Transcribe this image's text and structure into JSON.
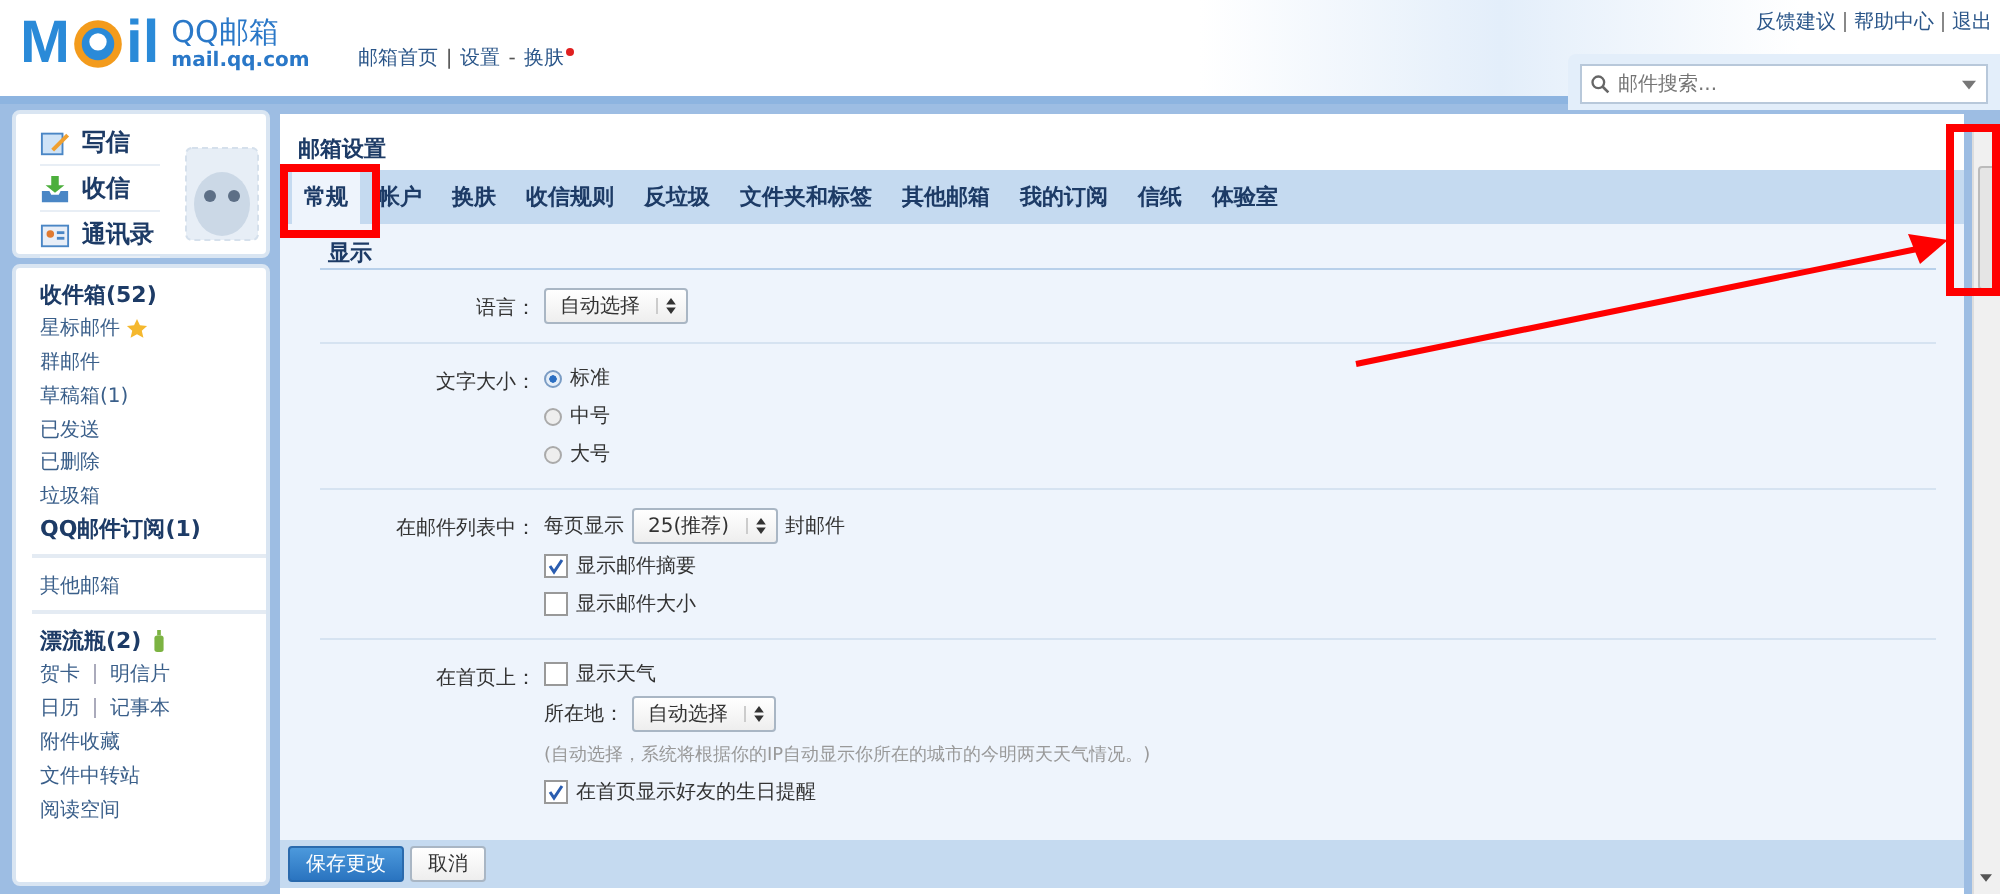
{
  "header": {
    "logo": {
      "left": "M",
      "right": "il"
    },
    "brand": "QQ邮箱",
    "domain": "mail.qq.com",
    "nav": [
      {
        "label": "邮箱首页",
        "sep": "|"
      },
      {
        "label": "设置",
        "sep": "-"
      },
      {
        "label": "换肤",
        "dot": true
      }
    ],
    "links": [
      {
        "label": "反馈建议"
      },
      {
        "label": "帮助中心"
      },
      {
        "label": "退出"
      }
    ],
    "search": {
      "placeholder": "邮件搜索..."
    }
  },
  "sidebar": {
    "actions": [
      {
        "label": "写信",
        "kind": "write"
      },
      {
        "label": "收信",
        "kind": "receive"
      },
      {
        "label": "通讯录",
        "kind": "contacts"
      }
    ],
    "groups": [
      [
        {
          "kind": "plain",
          "label": "收件箱(52)",
          "bold": true
        },
        {
          "kind": "star",
          "label": "星标邮件",
          "bold": false
        },
        {
          "kind": "plain",
          "label": "群邮件",
          "bold": false
        },
        {
          "kind": "plain",
          "label": "草稿箱(1)",
          "bold": false
        },
        {
          "kind": "plain",
          "label": "已发送",
          "bold": false
        },
        {
          "kind": "plain",
          "label": "已删除",
          "bold": false
        },
        {
          "kind": "plain",
          "label": "垃圾箱",
          "bold": false
        },
        {
          "kind": "plain",
          "label": "QQ邮件订阅(1)",
          "bold": true
        }
      ],
      [
        {
          "kind": "plain",
          "label": "其他邮箱",
          "bold": false
        }
      ],
      [
        {
          "kind": "bottle",
          "label": "漂流瓶(2)",
          "bold": true
        },
        {
          "kind": "pair",
          "label": "贺卡",
          "second": "明信片",
          "bold": false
        },
        {
          "kind": "pair",
          "label": "日历",
          "second": "记事本",
          "bold": false
        },
        {
          "kind": "plain",
          "label": "附件收藏",
          "bold": false
        },
        {
          "kind": "plain",
          "label": "文件中转站",
          "bold": false
        },
        {
          "kind": "plain",
          "label": "阅读空间",
          "bold": false
        }
      ]
    ]
  },
  "main": {
    "title": "邮箱设置",
    "tabs": [
      {
        "label": "常规",
        "selected": true
      },
      {
        "label": "帐户",
        "selected": false
      },
      {
        "label": "换肤",
        "selected": false
      },
      {
        "label": "收信规则",
        "selected": false
      },
      {
        "label": "反垃圾",
        "selected": false
      },
      {
        "label": "文件夹和标签",
        "selected": false
      },
      {
        "label": "其他邮箱",
        "selected": false
      },
      {
        "label": "我的订阅",
        "selected": false
      },
      {
        "label": "信纸",
        "selected": false
      },
      {
        "label": "体验室",
        "selected": false
      }
    ],
    "section": "显示",
    "rows": [
      {
        "label": "语言：",
        "lines": [
          {
            "kind": "select",
            "value": "自动选择"
          }
        ]
      },
      {
        "label": "文字大小：",
        "lines": [
          {
            "kind": "radio",
            "label": "标准",
            "selected": true
          },
          {
            "kind": "radio",
            "label": "中号",
            "selected": false
          },
          {
            "kind": "radio",
            "label": "大号",
            "selected": false
          }
        ]
      },
      {
        "label": "在邮件列表中：",
        "lines": [
          {
            "kind": "select",
            "prefix": "每页显示",
            "value": "25(推荐)",
            "suffix": "封邮件"
          },
          {
            "kind": "checkbox",
            "label": "显示邮件摘要",
            "checked": true
          },
          {
            "kind": "checkbox",
            "label": "显示邮件大小",
            "checked": false
          }
        ]
      },
      {
        "label": "在首页上：",
        "lines": [
          {
            "kind": "checkbox",
            "label": "显示天气",
            "checked": false
          },
          {
            "kind": "select",
            "prefix": "所在地：",
            "value": "自动选择"
          },
          {
            "kind": "note",
            "label": "(自动选择，系统将根据你的IP自动显示你所在的城市的今明两天天气情况。)"
          },
          {
            "kind": "checkbox",
            "label": "在首页显示好友的生日提醒",
            "checked": true
          }
        ]
      }
    ],
    "buttons": [
      {
        "label": "保存更改",
        "kind": "primary"
      },
      {
        "label": "取消",
        "kind": "normal"
      }
    ]
  }
}
